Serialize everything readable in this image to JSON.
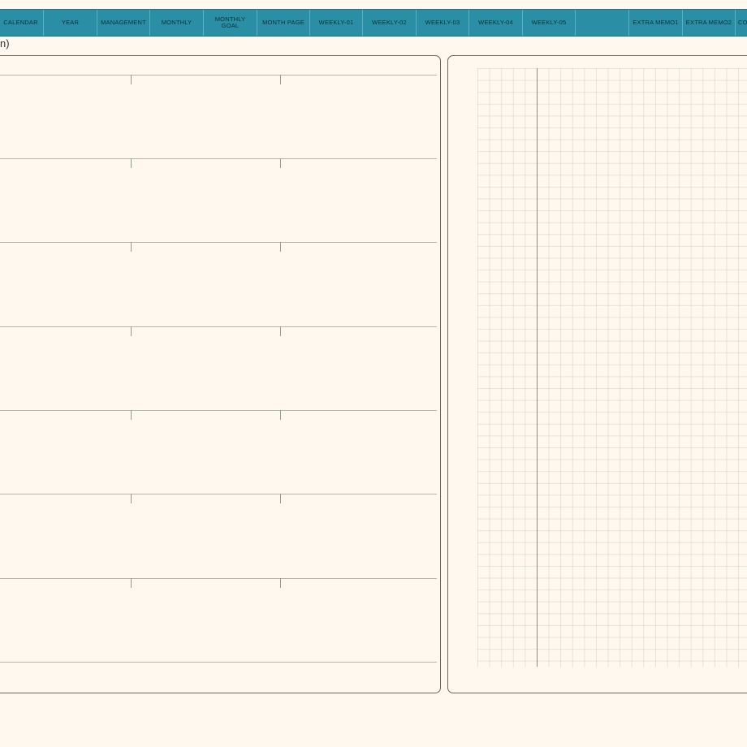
{
  "nav": {
    "tabs": [
      {
        "id": "calendar",
        "label": "CALENDAR"
      },
      {
        "id": "year",
        "label": "YEAR"
      },
      {
        "id": "management",
        "label": "MANAGEMENT"
      },
      {
        "id": "monthly",
        "label": "MONTHLY"
      },
      {
        "id": "monthly-goal",
        "label": "MONTHLY\nGOAL"
      },
      {
        "id": "month-page",
        "label": "MONTH PAGE"
      },
      {
        "id": "weekly-01",
        "label": "WEEKLY-01"
      },
      {
        "id": "weekly-02",
        "label": "WEEKLY-02"
      },
      {
        "id": "weekly-03",
        "label": "WEEKLY-03"
      },
      {
        "id": "weekly-04",
        "label": "WEEKLY-04"
      },
      {
        "id": "weekly-05",
        "label": "WEEKLY-05"
      },
      {
        "id": "blank",
        "label": ""
      },
      {
        "id": "extra-memo1",
        "label": "EXTRA MEMO1"
      },
      {
        "id": "extra-memo2",
        "label": "EXTRA MEMO2"
      },
      {
        "id": "extra-cut",
        "label": "CO"
      }
    ],
    "colors": {
      "bar": "#2a8fa5",
      "text": "#0d2f37"
    }
  },
  "page": {
    "partial_label": "n)"
  },
  "colors": {
    "background": "#fff8ee",
    "panel_border": "#6a655c",
    "rule_line": "#b8b3ab"
  }
}
